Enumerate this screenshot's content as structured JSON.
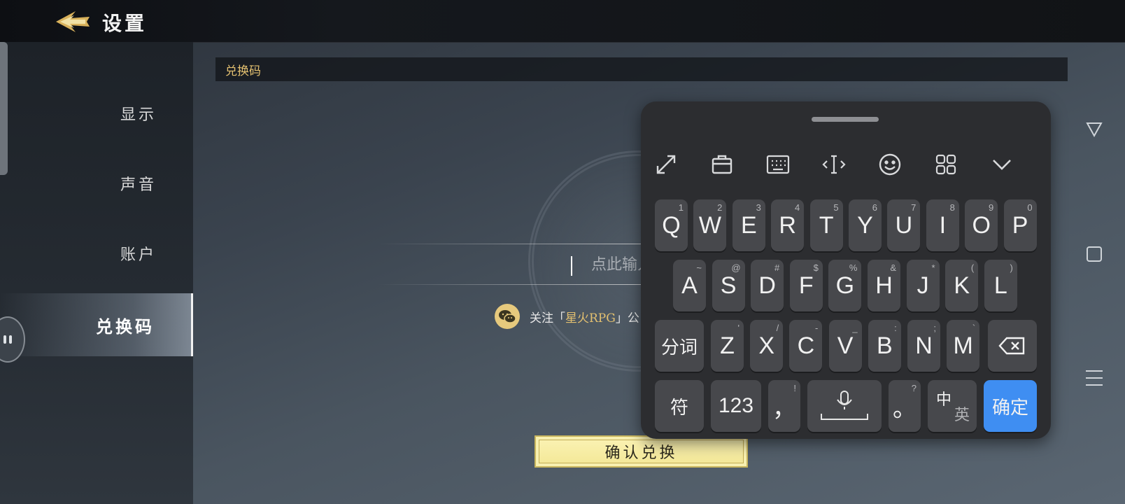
{
  "header": {
    "title": "设置",
    "back_icon": "back-arrow-icon"
  },
  "sidebar": {
    "items": [
      {
        "label": "显示",
        "active": false
      },
      {
        "label": "声音",
        "active": false
      },
      {
        "label": "账户",
        "active": false
      },
      {
        "label": "兑换码",
        "active": true
      }
    ]
  },
  "redeem": {
    "section_title": "兑换码",
    "input_placeholder": "点此输入兑换码",
    "input_value": "",
    "wechat_prefix": "关注「",
    "wechat_name": "星火RPG",
    "wechat_suffix": "」公",
    "confirm_label": "确认兑换"
  },
  "keyboard": {
    "toolbar_icons": [
      "expand-icon",
      "clipboard-icon",
      "keyboard-icon",
      "cursor-move-icon",
      "emoji-icon",
      "grid-icon",
      "collapse-keyboard-icon"
    ],
    "row1": [
      {
        "k": "Q",
        "s": "1"
      },
      {
        "k": "W",
        "s": "2"
      },
      {
        "k": "E",
        "s": "3"
      },
      {
        "k": "R",
        "s": "4"
      },
      {
        "k": "T",
        "s": "5"
      },
      {
        "k": "Y",
        "s": "6"
      },
      {
        "k": "U",
        "s": "7"
      },
      {
        "k": "I",
        "s": "8"
      },
      {
        "k": "O",
        "s": "9"
      },
      {
        "k": "P",
        "s": "0"
      }
    ],
    "row2": [
      {
        "k": "A",
        "s": "~"
      },
      {
        "k": "S",
        "s": "@"
      },
      {
        "k": "D",
        "s": "#"
      },
      {
        "k": "F",
        "s": "$"
      },
      {
        "k": "G",
        "s": "%"
      },
      {
        "k": "H",
        "s": "&"
      },
      {
        "k": "J",
        "s": "*"
      },
      {
        "k": "K",
        "s": "("
      },
      {
        "k": "L",
        "s": ")"
      }
    ],
    "row3": [
      {
        "k": "Z",
        "s": "'"
      },
      {
        "k": "X",
        "s": "/"
      },
      {
        "k": "C",
        "s": "-"
      },
      {
        "k": "V",
        "s": "_"
      },
      {
        "k": "B",
        "s": ":"
      },
      {
        "k": "N",
        "s": ";"
      },
      {
        "k": "M",
        "s": "`"
      }
    ],
    "segment_label": "分词",
    "symbol_label": "符",
    "number_label": "123",
    "comma_label": "，",
    "comma_sub": "!",
    "period_label": "。",
    "period_sub": "?",
    "lang_primary": "中",
    "lang_secondary": "英",
    "enter_label": "确定"
  },
  "sysnav": {
    "icons": [
      "back-triangle-icon",
      "home-square-icon",
      "menu-lines-icon"
    ]
  }
}
